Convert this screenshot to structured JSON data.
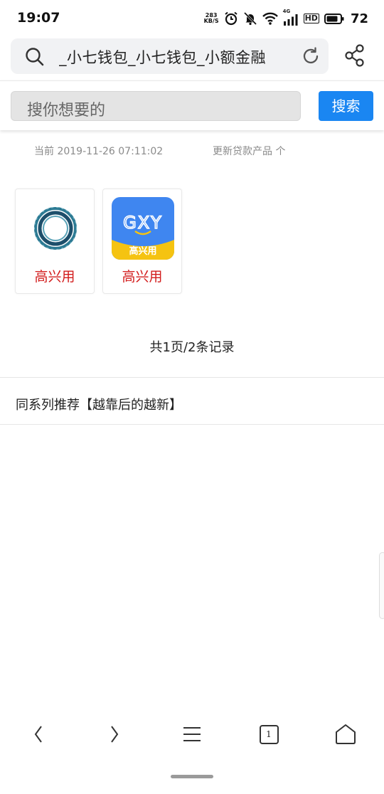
{
  "status_bar": {
    "time": "19:07",
    "net_speed_value": "283",
    "net_speed_unit": "KB/S",
    "network_type": "4G",
    "hd_label": "HD",
    "battery_level": "72",
    "icons": [
      "alarm-icon",
      "mute-icon",
      "wifi-icon",
      "signal-icon",
      "battery-icon"
    ]
  },
  "browser": {
    "url_text": "_小七钱包_小七钱包_小额金融",
    "icons": [
      "search-icon",
      "refresh-icon",
      "share-icon"
    ]
  },
  "search": {
    "placeholder": "搜你想要的",
    "button_label": "搜索",
    "button_color": "#1a86f2"
  },
  "info": {
    "current_time": "当前 2019-11-26 07:11:02",
    "updated_products": "更新贷款产品 个"
  },
  "products": [
    {
      "name": "高兴用",
      "logo": "circle-ring-logo"
    },
    {
      "name": "高兴用",
      "logo": "gxy-logo",
      "logo_text": "GXY",
      "logo_banner": "高兴用"
    }
  ],
  "product_name_color": "#d21b1b",
  "pagination": {
    "text": "共1页/2条记录"
  },
  "series": {
    "title": "同系列推荐【越靠后的越新】"
  },
  "bottom_nav": {
    "tab_count": "1",
    "icons": [
      "back-icon",
      "forward-icon",
      "menu-icon",
      "tabs-icon",
      "home-icon"
    ]
  }
}
